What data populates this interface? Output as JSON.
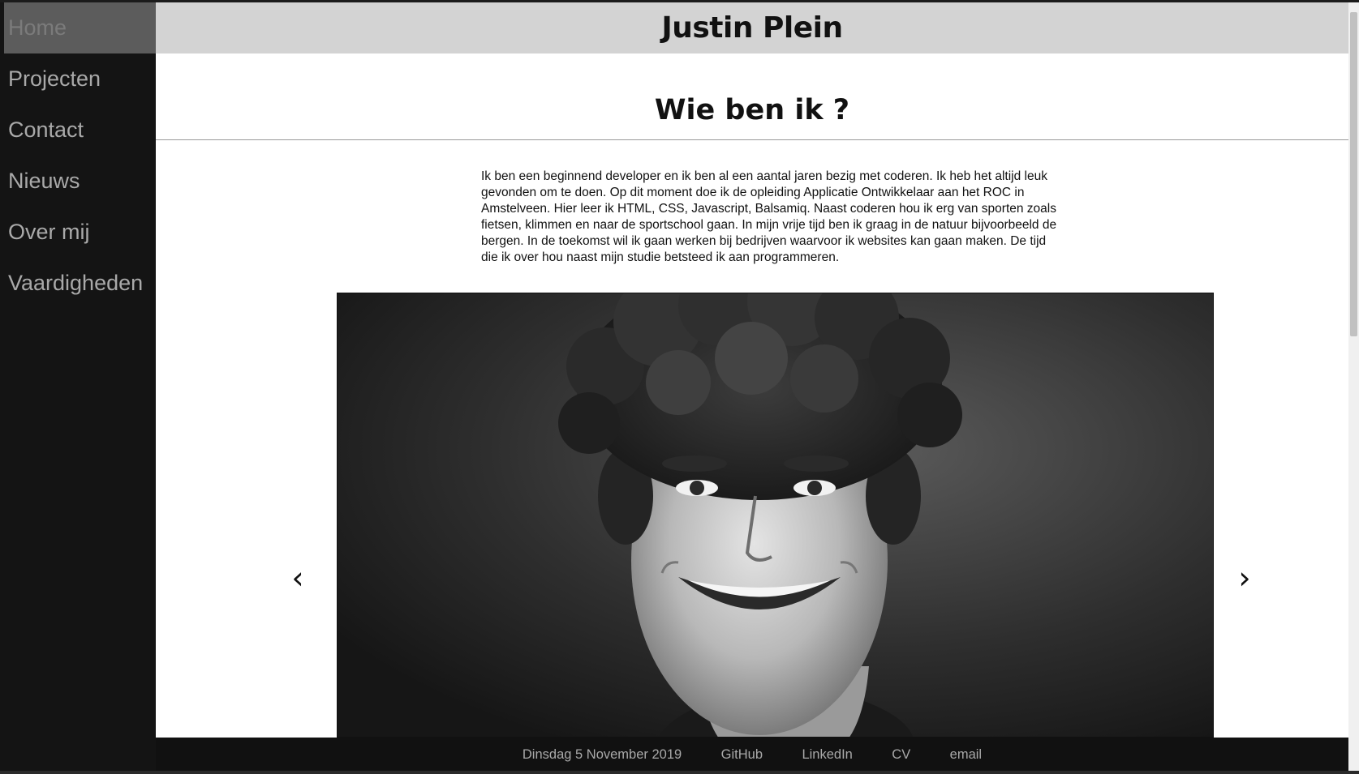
{
  "nav": {
    "items": [
      {
        "label": "Home",
        "active": true
      },
      {
        "label": "Projecten"
      },
      {
        "label": "Contact"
      },
      {
        "label": "Nieuws"
      },
      {
        "label": "Over mij"
      },
      {
        "label": "Vaardigheden"
      }
    ]
  },
  "header": {
    "title": "Justin Plein"
  },
  "main": {
    "section_title": "Wie ben ik ?",
    "intro": "Ik ben een beginnend developer en ik ben al een aantal jaren bezig met coderen. Ik heb het altijd leuk gevonden om te doen. Op dit moment doe ik de opleiding Applicatie Ontwikkelaar aan het ROC in Amstelveen. Hier leer ik HTML, CSS, Javascript, Balsamiq. Naast coderen hou ik erg van sporten zoals fietsen, klimmen en naar de sportschool gaan. In mijn vrije tijd ben ik graag in de natuur bijvoorbeeld de bergen. In de toekomst wil ik gaan werken bij bedrijven waarvoor ik websites kan gaan maken. De tijd die ik over hou naast mijn studie betsteed ik aan programmeren."
  },
  "slider": {
    "prev_icon": "‹",
    "next_icon": "›"
  },
  "footer": {
    "date": "Dinsdag 5 November 2019",
    "links": [
      "GitHub",
      "LinkedIn",
      "CV",
      "email"
    ]
  },
  "colors": {
    "sidebar": "#141414",
    "header": "#d3d3d3",
    "footer": "#111111",
    "nav_text": "#a9a9a9"
  }
}
